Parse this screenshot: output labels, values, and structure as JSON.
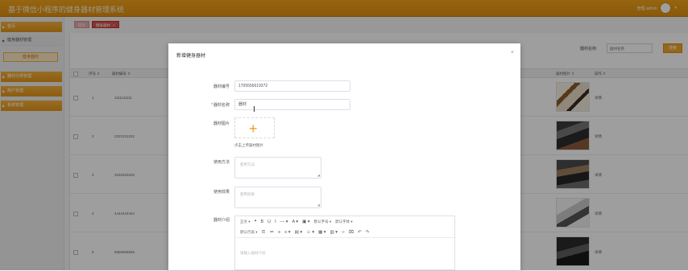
{
  "header": {
    "app_title": "基于微信小程序的健身器材管理系统",
    "user_label": "管理 admin"
  },
  "sidebar": {
    "items": [
      {
        "label": "首页"
      },
      {
        "label": "健身器材管理"
      },
      {
        "label": "健身器材"
      },
      {
        "label": "器材分类管理"
      },
      {
        "label": "用户管理"
      },
      {
        "label": "系统管理"
      }
    ]
  },
  "tabs": [
    {
      "label": "首页"
    },
    {
      "label": "健身器材"
    }
  ],
  "search": {
    "label": "器材名称:",
    "placeholder": "器材名称",
    "button_label": "搜索"
  },
  "table": {
    "columns": [
      "序号 ⇕",
      "器材编号 ⇕",
      "器材图片 ⇕",
      "操作 ⇕"
    ],
    "rows": [
      {
        "index": "1",
        "code": "1111111111",
        "action": "详情"
      },
      {
        "index": "2",
        "code": "2222222222",
        "action": "详情"
      },
      {
        "index": "3",
        "code": "3333333333",
        "action": "详情"
      },
      {
        "index": "4",
        "code": "4444444444",
        "action": "详情"
      },
      {
        "index": "5",
        "code": "5555555555",
        "action": "详情"
      }
    ]
  },
  "modal": {
    "title": "新增健身器材",
    "close": "×",
    "fields": {
      "code_label": "器材编号",
      "code_value": "1705556619372",
      "name_label": "器材名称",
      "name_value": "器材",
      "image_label": "器材图片",
      "upload_tip": "点击上传器材图片",
      "usage_label": "使用方法",
      "usage_placeholder": "使用方法",
      "effect_label": "使用效果",
      "effect_placeholder": "使用效果",
      "intro_label": "器材介绍",
      "intro_placeholder": "请输入器材介绍"
    },
    "editor_toolbar": {
      "row1": [
        "正文 ▾",
        "❝",
        "B",
        "U",
        "I",
        "— ▾",
        "A ▾",
        "▣ ▾",
        "默认字号 ▾",
        "默认字体 ▾"
      ],
      "row2": [
        "默认行高 ▾",
        "☰",
        "≔",
        "≡",
        "≡ ▾",
        "▤ ▾",
        "☺ ▾",
        "▦ ▾",
        "▥ ▾",
        "‹›",
        "⌧",
        "↶",
        "↷"
      ]
    }
  },
  "colors": {
    "brand": "#f0a72a",
    "danger": "#d9534f",
    "upload_plus": "#f0a11e"
  }
}
